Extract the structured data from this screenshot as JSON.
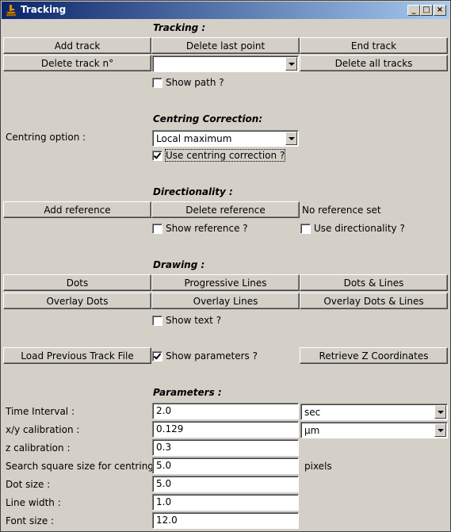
{
  "window": {
    "title": "Tracking",
    "controls": {
      "minimize": "_",
      "maximize": "□",
      "close": "×"
    }
  },
  "tracking": {
    "heading": "Tracking :",
    "add_track": "Add track",
    "delete_last_point": "Delete last point",
    "end_track": "End track",
    "delete_track_n": "Delete track n°",
    "track_select_value": "",
    "delete_all_tracks": "Delete all tracks",
    "show_path": "Show path ?"
  },
  "centring": {
    "heading": "Centring Correction:",
    "option_label": "Centring option :",
    "option_value": "Local maximum",
    "use_correction": "Use centring correction ?"
  },
  "directionality": {
    "heading": "Directionality :",
    "add_reference": "Add reference",
    "delete_reference": "Delete reference",
    "status": "No reference set",
    "show_reference": "Show reference ?",
    "use_directionality": "Use directionality ?"
  },
  "drawing": {
    "heading": "Drawing :",
    "dots": "Dots",
    "progressive_lines": "Progressive Lines",
    "dots_lines": "Dots & Lines",
    "overlay_dots": "Overlay Dots",
    "overlay_lines": "Overlay Lines",
    "overlay_dots_lines": "Overlay Dots & Lines",
    "show_text": "Show text ?"
  },
  "misc": {
    "load_previous": "Load Previous Track File",
    "show_parameters": "Show parameters ?",
    "retrieve_z": "Retrieve Z Coordinates"
  },
  "parameters": {
    "heading": "Parameters :",
    "time_interval_label": "Time Interval :",
    "time_interval_value": "2.0",
    "time_unit": "sec",
    "xy_label": "x/y calibration :",
    "xy_value": "0.129",
    "xy_unit": "µm",
    "z_label": "z calibration :",
    "z_value": "0.3",
    "search_label": "Search square size for centring:",
    "search_value": "5.0",
    "search_unit": "pixels",
    "dot_label": "Dot size :",
    "dot_value": "5.0",
    "line_label": "Line width :",
    "line_value": "1.0",
    "font_label": "Font size :",
    "font_value": "12.0"
  }
}
